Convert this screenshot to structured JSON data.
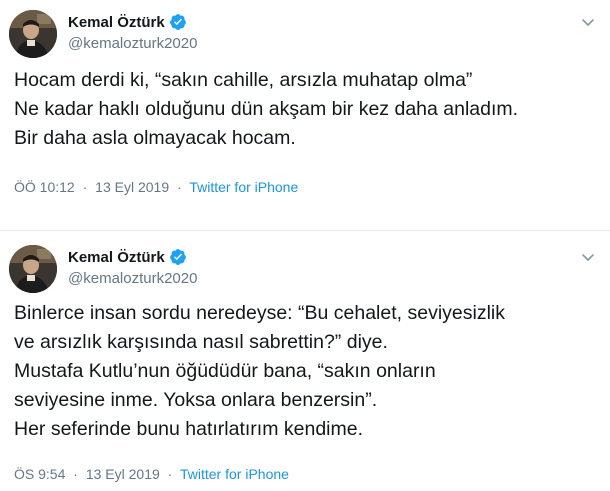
{
  "colors": {
    "verified_badge": "#1da1f2",
    "link": "#1b95e0",
    "secondary_text": "#657786",
    "divider": "#e6ecf0"
  },
  "tweets": [
    {
      "user": {
        "display_name": "Kemal Öztürk",
        "handle": "@kemalozturk2020",
        "verified_icon": "verified-badge-icon"
      },
      "lines": [
        "Hocam derdi ki, “sakın cahille, arsızla muhatap olma”",
        "Ne kadar haklı olduğunu dün akşam bir kez daha anladım.",
        "Bir daha asla olmayacak hocam."
      ],
      "time": "ÖÖ 10:12",
      "separator": "·",
      "date": "13 Eyl 2019",
      "source": "Twitter for iPhone"
    },
    {
      "user": {
        "display_name": "Kemal Öztürk",
        "handle": "@kemalozturk2020",
        "verified_icon": "verified-badge-icon"
      },
      "lines": [
        "Binlerce insan sordu neredeyse: “Bu cehalet, seviyesizlik",
        "ve arsızlık karşısında nasıl sabrettin?” diye.",
        "Mustafa Kutlu’nun öğüdüdür bana, “sakın onların",
        "seviyesine inme. Yoksa onlara benzersin”.",
        "Her seferinde bunu hatırlatırım kendime."
      ],
      "time": "ÖS 9:54",
      "separator": "·",
      "date": "13 Eyl 2019",
      "source": "Twitter for iPhone"
    }
  ]
}
